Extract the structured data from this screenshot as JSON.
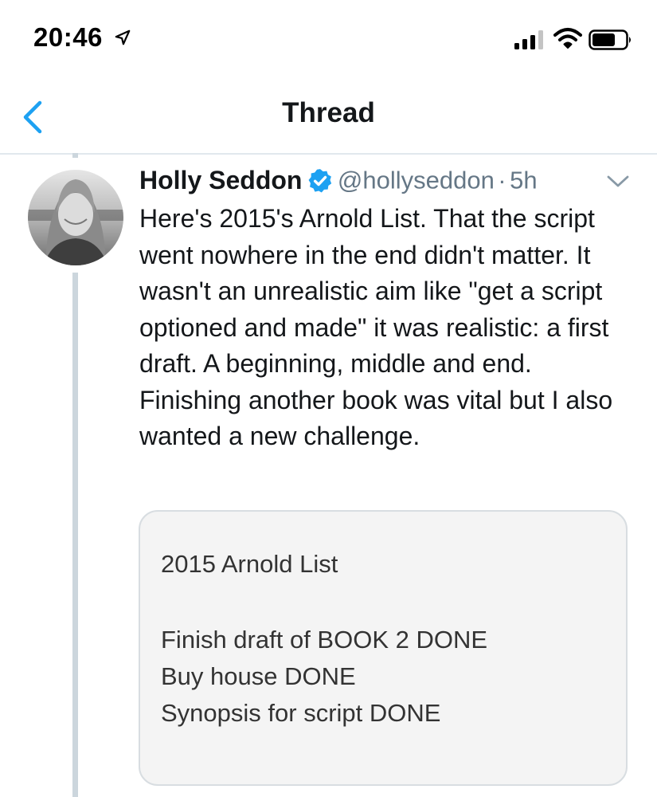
{
  "status_bar": {
    "time": "20:46",
    "icons": [
      "location-arrow-icon",
      "signal-icon",
      "wifi-icon",
      "battery-icon"
    ]
  },
  "nav": {
    "title": "Thread",
    "back_icon": "chevron-left-icon"
  },
  "tweet": {
    "display_name": "Holly Seddon",
    "verified": true,
    "handle": "@hollyseddon",
    "separator": "·",
    "time_ago": "5h",
    "text": "Here's 2015's Arnold List. That the script went nowhere in the end didn't matter. It wasn't an unrealistic aim like \"get a script optioned and made\" it was realistic: a first draft. A beginning, middle and end. Finishing another book was vital but I also wanted a new challenge.",
    "media": {
      "title": "2015 Arnold List",
      "lines": [
        "Finish draft of BOOK 2 DONE",
        "Buy house DONE",
        "Synopsis for script DONE"
      ]
    }
  },
  "colors": {
    "accent": "#1da1f2",
    "text_primary": "#14171a",
    "text_secondary": "#657786",
    "thread_line": "#ccd6dd",
    "divider": "#e1e8ed"
  }
}
